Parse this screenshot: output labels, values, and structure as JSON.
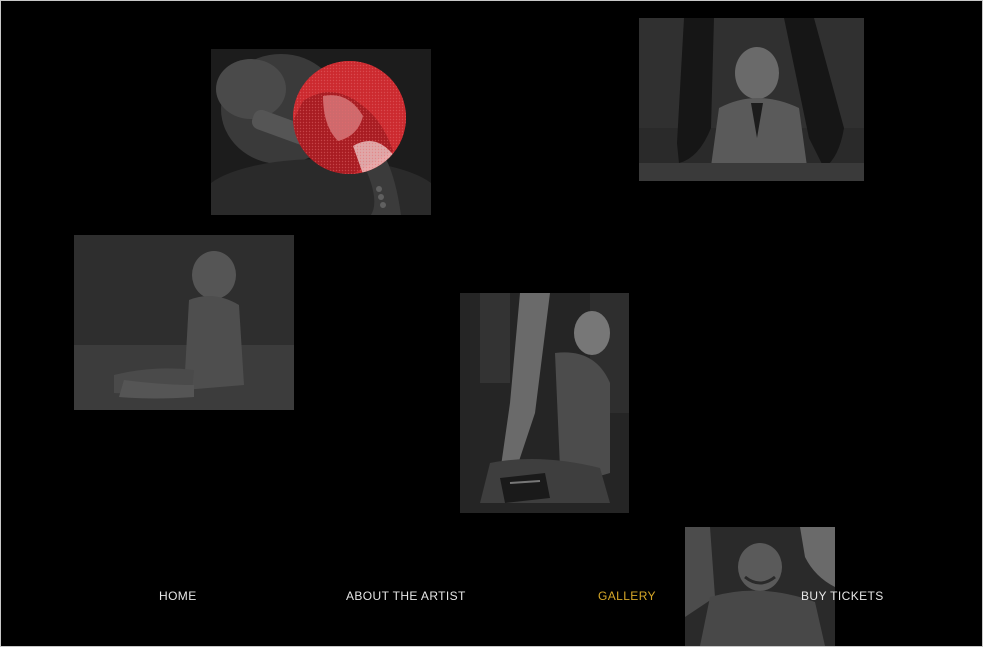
{
  "nav": {
    "items": [
      {
        "label": "HOME",
        "active": false
      },
      {
        "label": "ABOUT THE ARTIST",
        "active": false
      },
      {
        "label": "GALLERY",
        "active": true
      },
      {
        "label": "BUY TICKETS",
        "active": false
      }
    ],
    "colors": {
      "default": "#e6e6e6",
      "active": "#d6a728"
    }
  },
  "gallery": {
    "photos": [
      {
        "subject": "person-with-hand-on-face",
        "tint": "grayscale"
      },
      {
        "subject": "elderly-man-between-boots",
        "tint": "grayscale"
      },
      {
        "subject": "baby-sitting",
        "tint": "grayscale"
      },
      {
        "subject": "man-kneeling-against-legs",
        "tint": "grayscale"
      },
      {
        "subject": "smiling-bald-man",
        "tint": "grayscale"
      }
    ],
    "highlight_color": "#cc2a2f"
  }
}
